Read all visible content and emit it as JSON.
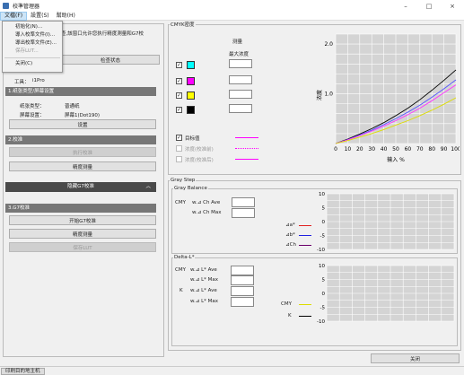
{
  "app": {
    "title": "校準管理器",
    "controls": {
      "min": "–",
      "max": "□",
      "close": "×"
    }
  },
  "menu": {
    "items": [
      {
        "label": "文檔(F)"
      },
      {
        "label": "設置(S)"
      },
      {
        "label": "幫助(H)"
      }
    ],
    "file_dropdown": [
      "初始化(N)...",
      "導入校準文件(I)...",
      "導出校準文件(E)...",
      "保存LUT...",
      "关闭(C)"
    ]
  },
  "left": {
    "hint": "查,該窗口允许您执行精度測量和G7校",
    "check_status_btn": "检查状态",
    "tool_label": "工具：",
    "tool_value": "i1Pro",
    "sec1": "1.纸张类型/屏幕设置",
    "paper_type_label": "纸张类型：",
    "paper_type_value": "普通纸",
    "screen_label": "屏幕设置：",
    "screen_value": "屏幕1(Dot190)",
    "settings_btn": "设置",
    "sec2": "2.校准",
    "exec_calib_btn": "执行校准",
    "precision_btn": "精度测量",
    "collapse_label": "隐藏G7校准",
    "sec3": "3.G7校准",
    "start_g7_btn": "开始G7校准",
    "precision_btn2": "精度测量",
    "save_lut_btn": "保存LUT"
  },
  "cmyk": {
    "group_title": "CMYK密度",
    "measure_label": "测量",
    "max_density_label": "最大浓度",
    "channels": [
      {
        "name": "C",
        "color": "#00ffff"
      },
      {
        "name": "M",
        "color": "#ff00ff"
      },
      {
        "name": "Y",
        "color": "#ffff00"
      },
      {
        "name": "K",
        "color": "#000000"
      }
    ],
    "legend": [
      {
        "label": "目标值",
        "style": "solid",
        "color": "#ff00ff",
        "enabled": true
      },
      {
        "label": "浓度(校准前)",
        "style": "dotted",
        "color": "#ff00ff",
        "enabled": false
      },
      {
        "label": "浓度(校准后)",
        "style": "solid",
        "color": "#ff00ff",
        "enabled": false
      }
    ]
  },
  "chart_data": {
    "type": "line",
    "xlabel": "输入 %",
    "ylabel": "浓度",
    "x": [
      0,
      10,
      20,
      30,
      40,
      50,
      60,
      70,
      80,
      90,
      100
    ],
    "xlim": [
      0,
      100
    ],
    "ylim": [
      0,
      2.2
    ],
    "yticks": [
      0,
      1.0,
      2.0
    ],
    "series": [
      {
        "color": "#000000",
        "values": [
          0,
          0.09,
          0.19,
          0.3,
          0.42,
          0.56,
          0.71,
          0.88,
          1.07,
          1.27,
          1.48
        ]
      },
      {
        "color": "#5555ff",
        "values": [
          0,
          0.08,
          0.17,
          0.27,
          0.38,
          0.5,
          0.63,
          0.77,
          0.93,
          1.1,
          1.28
        ]
      },
      {
        "color": "#ff33ff",
        "values": [
          0,
          0.075,
          0.16,
          0.25,
          0.35,
          0.46,
          0.58,
          0.71,
          0.86,
          1.02,
          1.18
        ]
      },
      {
        "color": "#dddd00",
        "values": [
          0,
          0.06,
          0.13,
          0.2,
          0.28,
          0.37,
          0.46,
          0.56,
          0.67,
          0.79,
          0.92
        ]
      }
    ],
    "grid": true
  },
  "graystep": {
    "group_title": "Gray Step",
    "balance_title": "Gray Balance",
    "cmy_label": "CMY",
    "ave_label": "w.⊿ Ch Ave",
    "max_label": "w.⊿ Ch Max",
    "legend": [
      {
        "label": "⊿a*",
        "color": "#e02020"
      },
      {
        "label": "⊿b*",
        "color": "#2020e0"
      },
      {
        "label": "⊿Ch",
        "color": "#6a006a"
      }
    ],
    "yticks": [
      "10",
      "5",
      "0",
      "-5",
      "-10"
    ],
    "delta_title": "Delta-L*",
    "d_cmy_label": "CMY",
    "d_k_label": "K",
    "lave_label": "w.⊿ L* Ave",
    "lmax_label": "w.⊿ L* Max",
    "dlegend": [
      {
        "label": "CMY",
        "color": "#dddd00"
      },
      {
        "label": "K",
        "color": "#000000"
      }
    ]
  },
  "footer": {
    "close_btn": "关闭",
    "status_tab": "印刷目的地主机"
  }
}
